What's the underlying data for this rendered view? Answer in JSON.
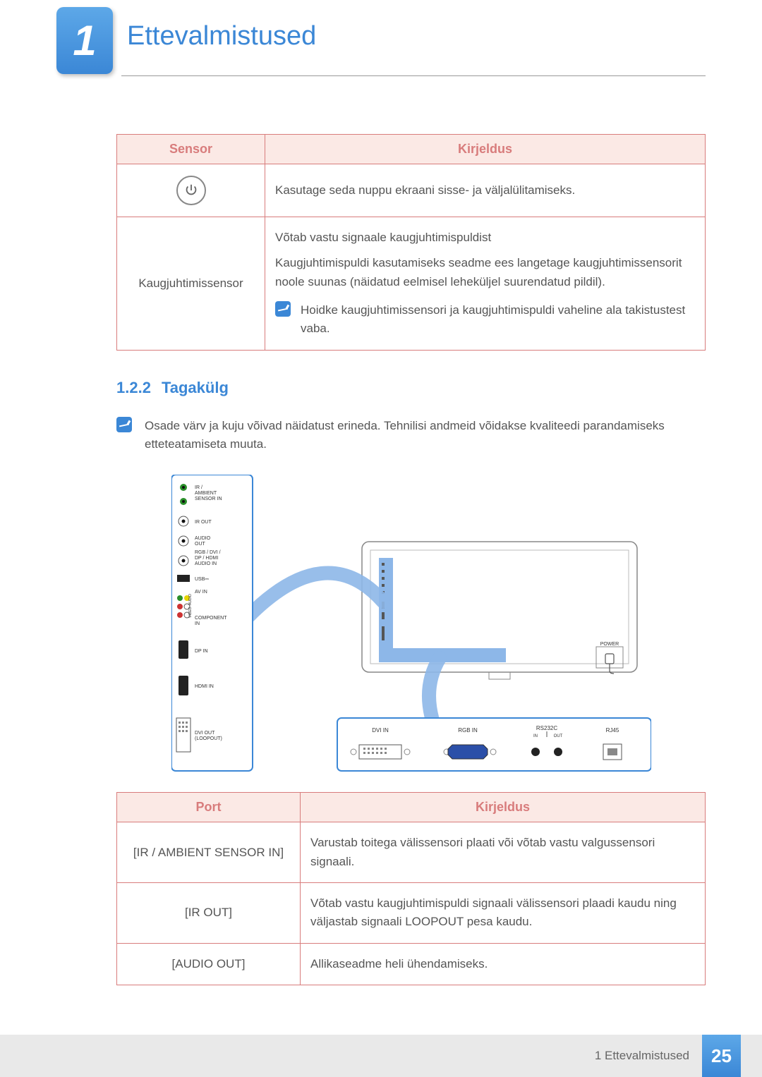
{
  "chapter": {
    "number": "1",
    "title": "Ettevalmistused"
  },
  "sensor_table": {
    "headers": {
      "col1": "Sensor",
      "col2": "Kirjeldus"
    },
    "rows": [
      {
        "sensor_label": "",
        "icon": "power",
        "description": "Kasutage seda nuppu ekraani sisse- ja väljalülitamiseks."
      },
      {
        "sensor_label": "Kaugjuhtimissensor",
        "description_line1": "Võtab vastu signaale kaugjuhtimispuldist",
        "description_line2": "Kaugjuhtimispuldi kasutamiseks seadme ees langetage kaugjuhtimissensorit noole suunas (näidatud eelmisel leheküljel suurendatud pildil).",
        "note": "Hoidke kaugjuhtimissensori ja kaugjuhtimispuldi vaheline ala takistustest vaba."
      }
    ]
  },
  "subsection": {
    "number": "1.2.2",
    "title": "Tagakülg"
  },
  "subsection_note": "Osade värv ja kuju võivad näidatust erineda. Tehnilisi andmeid võidakse kvaliteedi parandamiseks etteteatamiseta muuta.",
  "diagram_labels": {
    "ir_ambient": "IR / AMBIENT SENSOR IN",
    "ir_out": "IR OUT",
    "audio_out": "AUDIO OUT",
    "rgb_dvi_dp_hdmi_audio_in": "RGB / DVI / DP / HDMI AUDIO IN",
    "usb": "USB",
    "av_in": "AV IN",
    "component_in": "COMPONENT IN",
    "dp_in": "DP IN",
    "hdmi_in": "HDMI IN",
    "dvi_out": "DVI OUT (LOOPOUT)",
    "dvi_in": "DVI IN",
    "rgb_in": "RGB IN",
    "rs232c": "RS232C",
    "rs_in": "IN",
    "rs_out": "OUT",
    "rj45": "RJ45",
    "power": "POWER",
    "video": "VIDEO",
    "audio": "AUDIO"
  },
  "port_table": {
    "headers": {
      "col1": "Port",
      "col2": "Kirjeldus"
    },
    "rows": [
      {
        "port": "[IR / AMBIENT SENSOR IN]",
        "desc": "Varustab toitega välissensori plaati või võtab vastu valgussensori signaali."
      },
      {
        "port": "[IR OUT]",
        "desc": "Võtab vastu kaugjuhtimispuldi signaali välissensori plaadi kaudu ning väljastab signaali LOOPOUT pesa kaudu."
      },
      {
        "port": "[AUDIO OUT]",
        "desc": "Allikaseadme heli ühendamiseks."
      }
    ]
  },
  "footer": {
    "text": "1 Ettevalmistused",
    "page": "25"
  }
}
